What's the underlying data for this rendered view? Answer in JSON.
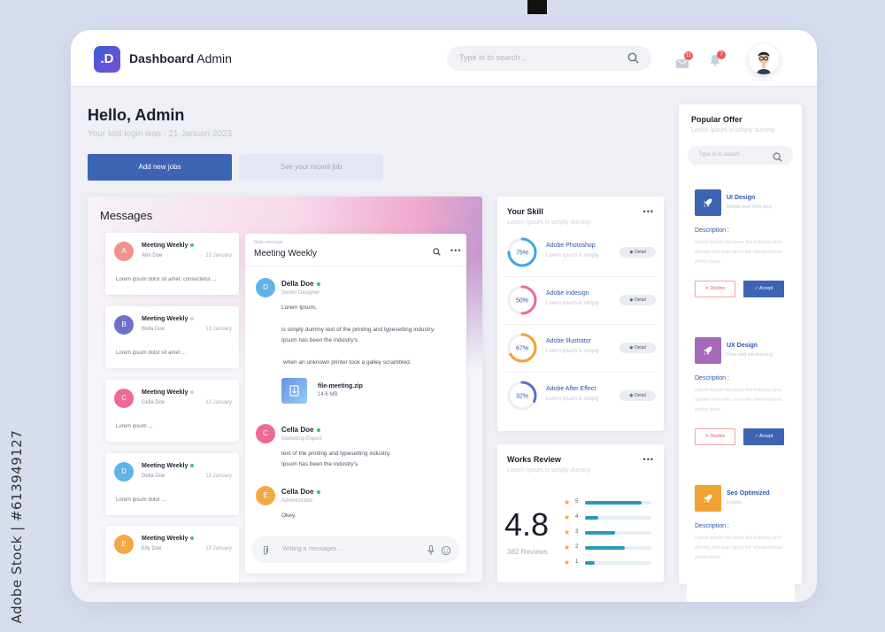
{
  "watermark": "Adobe Stock | #613949127",
  "header": {
    "logo_letter": ".D",
    "title_bold": "Dashboard",
    "title_light": "Admin",
    "search_placeholder": "Type in to search ..",
    "mail_badge": "11",
    "bell_badge": "7"
  },
  "greeting": {
    "title": "Hello, Admin",
    "last_login": "Your last login was : 21 Januari 2023",
    "primary_button": "Add new jobs",
    "secondary_button": "See your recent job"
  },
  "messages": {
    "title": "Messages",
    "list": [
      {
        "initial": "A",
        "name": "Meeting Weekly",
        "sender": "Ahn Doe",
        "date": "13 January",
        "preview": "Lorem ipsum dolor sit amet, consectetur ...",
        "color": "#f2938a"
      },
      {
        "initial": "B",
        "name": "Meeting Weekly",
        "sender": "Bella Doe",
        "date": "13 January",
        "preview": "Lorem ipsum dolor sit amet ...",
        "color": "#6d72c9"
      },
      {
        "initial": "C",
        "name": "Meeting Weekly",
        "sender": "Cella Doe",
        "date": "13 January",
        "preview": "Lorem ipsum ...",
        "color": "#ee6a94"
      },
      {
        "initial": "D",
        "name": "Meeting Weekly",
        "sender": "Della Doe",
        "date": "13 January",
        "preview": "Lorem ipsum dolor ...",
        "color": "#5db4e8"
      },
      {
        "initial": "E",
        "name": "Meeting Weekly",
        "sender": "Elly Doe",
        "date": "13 January",
        "preview": "",
        "color": "#f2a945"
      }
    ],
    "chat": {
      "kicker": "Main message",
      "title": "Meeting Weekly",
      "entries": [
        {
          "initial": "D",
          "name": "Della Doe",
          "role": "Senior Designer",
          "color": "#5db4e8",
          "lines": [
            "Lorem Ipsum,",
            "is simply dummy text of the printing and typesetting industry.",
            "Ipsum has been the industry's.",
            "when an unknown printer took a galley scrambled."
          ]
        },
        {
          "initial": "C",
          "name": "Cella Doe",
          "role": "Marketing Expert",
          "color": "#ee6a94",
          "lines": [
            "text of the printing and typesetting industry.",
            "Ipsum has been the industry's."
          ]
        },
        {
          "initial": "E",
          "name": "Cella Doe",
          "role": "Administrator",
          "color": "#f2a945",
          "lines": [
            "Okey."
          ]
        }
      ],
      "attachment": {
        "name": "file-meeting.zip",
        "size": "14.6 MB"
      },
      "compose_placeholder": "Writing a messages ..."
    }
  },
  "skills": {
    "title": "Your Skill",
    "subtitle": "Lorem Ipsum is simply dummy",
    "detail_label": "Detail",
    "items": [
      {
        "name": "Adobe Photoshop",
        "sub": "Lorem Ipsum is simply",
        "percent": 75,
        "label": "75%",
        "color": "#3fa8e0"
      },
      {
        "name": "Adobe Indesign",
        "sub": "Lorem Ipsum is simply",
        "percent": 50,
        "label": "50%",
        "color": "#ee6a94"
      },
      {
        "name": "Adobe Illustrator",
        "sub": "Lorem Ipsum is simply",
        "percent": 67,
        "label": "67%",
        "color": "#f0a232"
      },
      {
        "name": "Adobe After Effect",
        "sub": "Lorem Ipsum is simply",
        "percent": 32,
        "label": "32%",
        "color": "#5b6fc9"
      }
    ]
  },
  "reviews": {
    "title": "Works Review",
    "subtitle": "Lorem Ipsum is simply dummy",
    "rating": "4.8",
    "count": "382 Reviews",
    "bars": [
      {
        "stars": "5",
        "fraction": 0.85
      },
      {
        "stars": "4",
        "fraction": 0.2
      },
      {
        "stars": "3",
        "fraction": 0.45
      },
      {
        "stars": "2",
        "fraction": 0.6
      },
      {
        "stars": "1",
        "fraction": 0.15
      }
    ]
  },
  "offers": {
    "title": "Popular Offer",
    "subtitle": "Lorem Ipsum is simply dummy",
    "search_placeholder": "Type in to search ..",
    "description_heading": "Description :",
    "description": "Lorem Ipsum has been the industry and dummy text ever since the whene known printer book.",
    "decline_label": "Decline",
    "accept_label": "Accept",
    "items": [
      {
        "name": "UI Design",
        "sub": "Mobile and Web App",
        "color": "#3d63b3"
      },
      {
        "name": "UX Design",
        "sub": "Flow and wireframing",
        "color": "#a56ab8"
      },
      {
        "name": "Seo Optimized",
        "sub": "Engine",
        "color": "#f0a232"
      }
    ]
  }
}
